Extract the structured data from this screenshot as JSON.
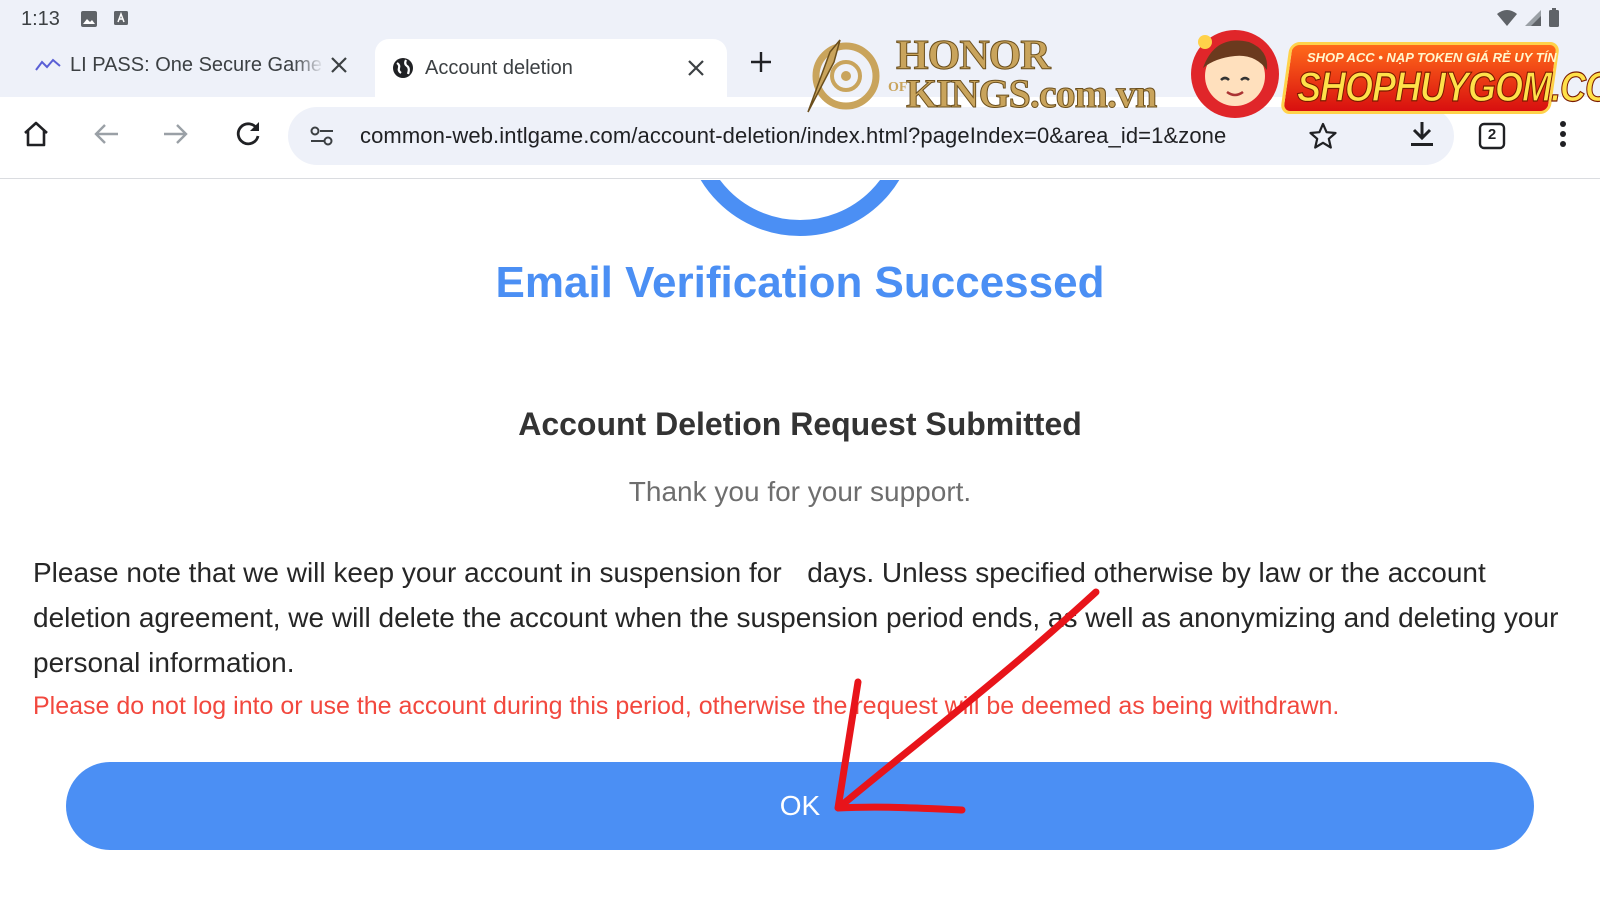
{
  "status_bar": {
    "time": "1:13"
  },
  "tabs": [
    {
      "title": "LI PASS: One Secure Game Account",
      "active": false
    },
    {
      "title": "Account deletion",
      "active": true
    }
  ],
  "toolbar": {
    "url": "common-web.intlgame.com/account-deletion/index.html?pageIndex=0&area_id=1&zone",
    "tab_count": "2"
  },
  "watermarks": {
    "honor_line1": "HONOR",
    "honor_of": "OF",
    "honor_line2": "KINGS.com.vn",
    "shop_tagline": "SHOP ACC • NẠP TOKEN GIÁ RẺ UY TÍN",
    "shop_name": "SHOPHUYGOM.COM"
  },
  "page": {
    "headline": "Email Verification Successed",
    "subhead": "Account Deletion Request Submitted",
    "thanks": "Thank you for your support.",
    "notice_before_days": "Please note that we will keep your account in suspension for ",
    "notice_after_days": " days. Unless specified otherwise by law or the account deletion agreement, we will delete the account when the suspension period ends, as well as anonymizing and deleting your personal information.",
    "warning": "Please do not log into or use the account during this period, otherwise the request will be deemed as being withdrawn.",
    "ok_label": "OK"
  },
  "colors": {
    "accent_blue": "#4b8ff4",
    "warning_red": "#f2483e",
    "annotation_red": "#e8141a",
    "chrome_bg": "#eef1f9"
  },
  "icons": [
    "image-icon",
    "keyboard-icon",
    "wifi-icon",
    "signal-icon",
    "battery-icon",
    "lipass-favicon-icon",
    "globe-icon",
    "close-icon",
    "plus-icon",
    "home-icon",
    "back-icon",
    "forward-icon",
    "reload-icon",
    "site-settings-icon",
    "star-icon",
    "download-icon",
    "tab-switcher-icon",
    "more-vert-icon",
    "success-ring-icon",
    "red-arrow-annotation"
  ]
}
